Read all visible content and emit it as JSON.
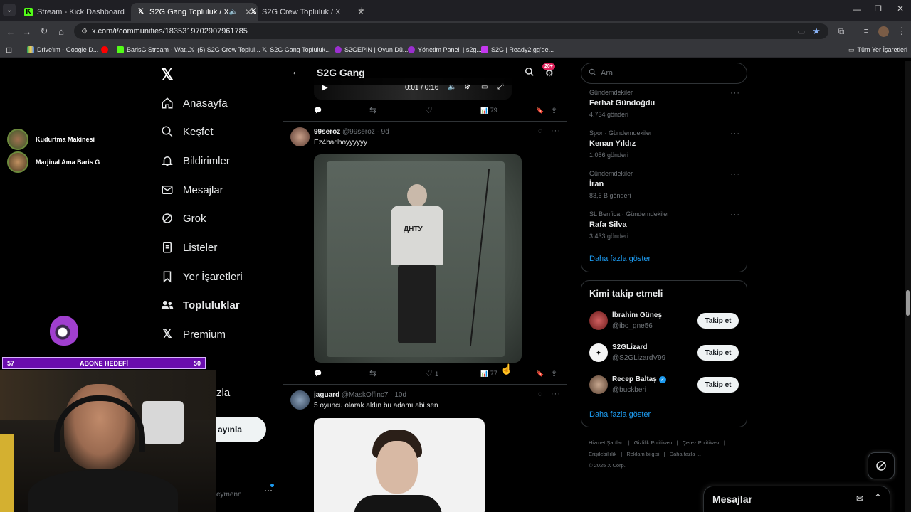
{
  "browser": {
    "tabs": [
      {
        "label": "Stream - Kick Dashboard",
        "icon": "kick-icon"
      },
      {
        "label": "S2G Gang Topluluk / X",
        "icon": "x-icon"
      },
      {
        "label": "S2G Crew Topluluk / X",
        "icon": "x-icon"
      }
    ],
    "url": "x.com/i/communities/1835319702907961785",
    "bookmarks": [
      "Drive'ım - Google D...",
      "BarisG Stream - Wat...",
      "(5) S2G Crew Toplul...",
      "S2G Gang Topluluk...",
      "S2GEPIN | Oyun Dü...",
      "Yönetim Paneli | s2g...",
      "S2G | Ready2.gg'de..."
    ],
    "all_bookmarks": "Tüm Yer İşaretleri"
  },
  "overlay": {
    "viewers": [
      "Kudurtma Makinesi",
      "Marjinal Ama Baris G"
    ],
    "goal": {
      "left": "57",
      "label": "ABONE HEDEFİ",
      "right": "50"
    }
  },
  "nav": {
    "items": [
      "Anasayfa",
      "Keşfet",
      "Bildirimler",
      "Mesajlar",
      "Grok",
      "Listeler",
      "Yer İşaretleri",
      "Topluluklar",
      "Premium"
    ],
    "more_partial": "zla",
    "post_partial": "ayınla",
    "user_partial": "eymenn"
  },
  "header": {
    "title": "S2G Gang",
    "badge": "20+"
  },
  "video_top": {
    "time": "0:01 / 0:16",
    "views": "79"
  },
  "posts": [
    {
      "name": "99seroz",
      "handle": "@99seroz",
      "age": "9d",
      "text": "Ez4badboyyyyyy",
      "likes": "1",
      "views": "77",
      "shirt": "ДНТУ"
    },
    {
      "name": "jaguard",
      "handle": "@MaskOffinc7",
      "age": "10d",
      "text": "5 oyuncu olarak aldın bu adamı abi sen"
    }
  ],
  "search": {
    "placeholder": "Ara"
  },
  "trends": [
    {
      "category": "Gündemdekiler",
      "name": "Ferhat Gündoğdu",
      "count": "4.734 gönderi"
    },
    {
      "category": "Spor · Gündemdekiler",
      "name": "Kenan Yıldız",
      "count": "1.056 gönderi"
    },
    {
      "category": "Gündemdekiler",
      "name": "İran",
      "count": "83,6 B gönderi"
    },
    {
      "category": "SL Benfica · Gündemdekiler",
      "name": "Rafa Silva",
      "count": "3.433 gönderi"
    }
  ],
  "trends_more": "Daha fazla göster",
  "who_to_follow": {
    "title": "Kimi takip etmeli",
    "users": [
      {
        "name": "İbrahim Güneş",
        "handle": "@ibo_gne56",
        "verified": false
      },
      {
        "name": "S2GLizard",
        "handle": "@S2GLizardV99",
        "verified": false
      },
      {
        "name": "Recep Baltaş",
        "handle": "@buckberi",
        "verified": true
      }
    ],
    "follow_label": "Takip et",
    "more": "Daha fazla göster"
  },
  "footer": {
    "links": [
      "Hizmet Şartları",
      "Gizlilik Politikası",
      "Çerez Politikası",
      "Erişilebilirlik",
      "Reklam bilgisi",
      "Daha fazla ..."
    ],
    "copyright": "© 2025 X Corp."
  },
  "messages_drawer": {
    "title": "Mesajlar"
  },
  "colors": {
    "accent": "#1d9bf0",
    "goal_bar": "#6a0dad",
    "kick": "#53fc18"
  }
}
